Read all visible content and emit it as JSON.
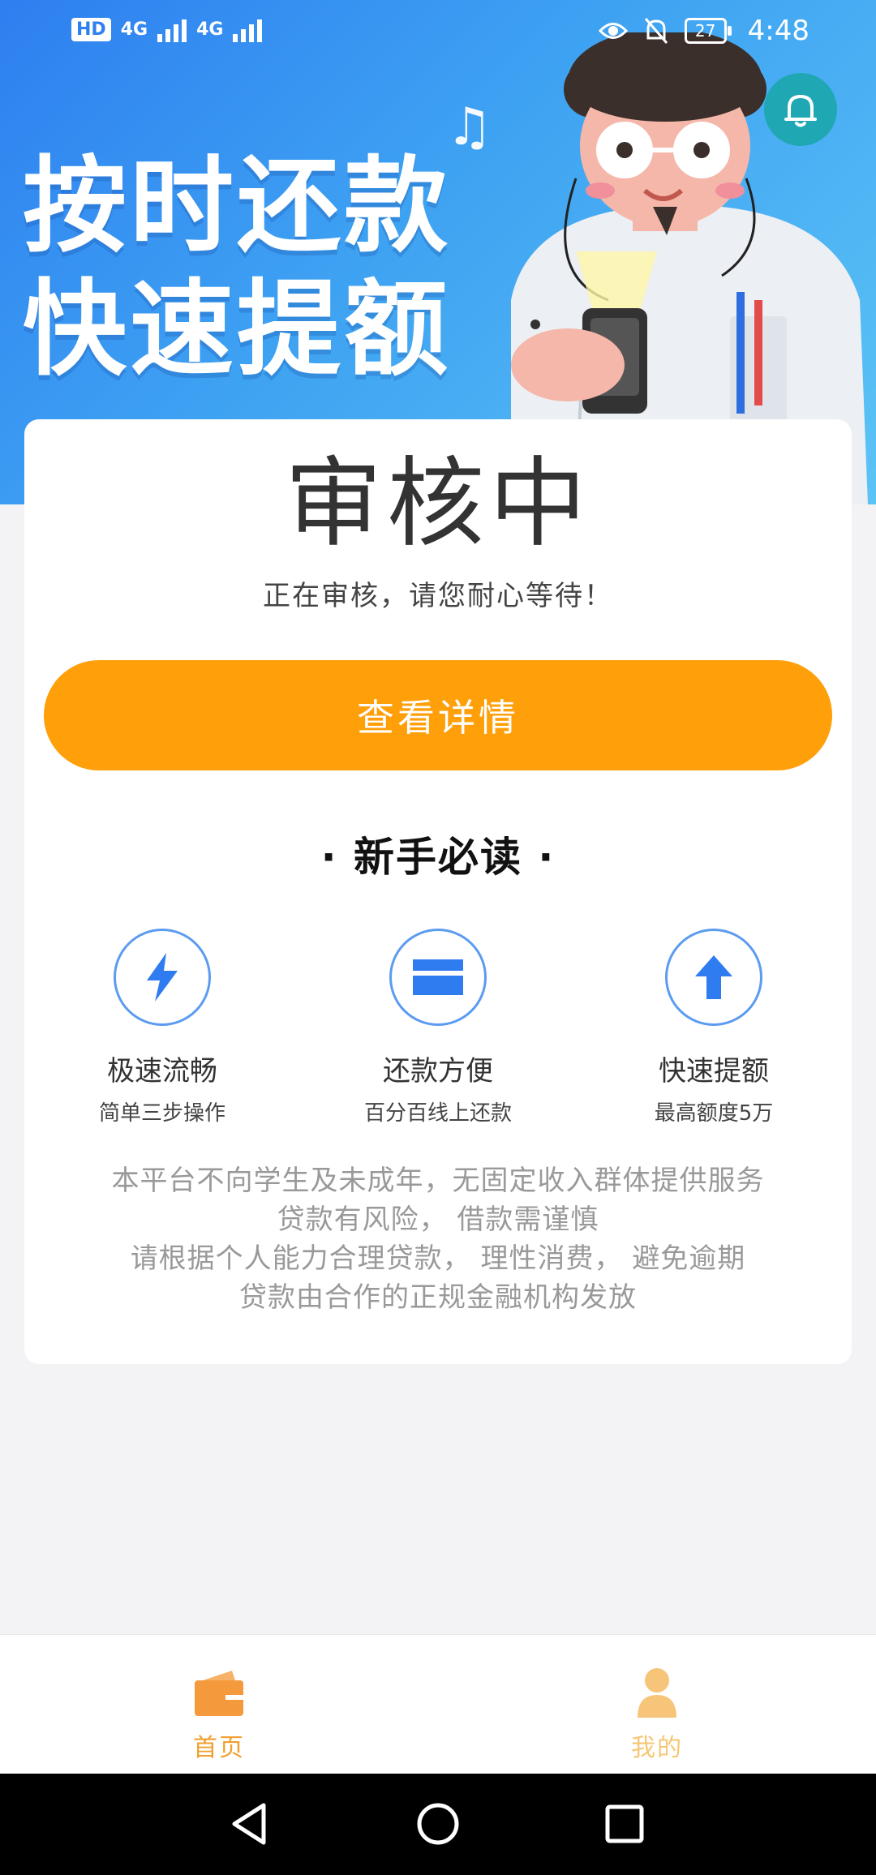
{
  "status_bar": {
    "network_badge": "HD",
    "signal1_label": "4G",
    "signal2_label": "4G",
    "battery": "27",
    "time": "4:48",
    "icons": [
      "eye-icon",
      "bell-off-icon",
      "battery-icon"
    ]
  },
  "banner": {
    "line1": "按时还款",
    "line2": "快速提额",
    "notification_icon": "bell-icon"
  },
  "review": {
    "title": "审核中",
    "description": "正在审核，请您耐心等待！",
    "button_label": "查看详情"
  },
  "guide": {
    "title": "· 新手必读 ·",
    "features": [
      {
        "icon": "lightning-icon",
        "title": "极速流畅",
        "subtitle": "简单三步操作"
      },
      {
        "icon": "card-icon",
        "title": "还款方便",
        "subtitle": "百分百线上还款"
      },
      {
        "icon": "arrow-up-icon",
        "title": "快速提额",
        "subtitle": "最高额度5万"
      }
    ]
  },
  "disclaimer": [
    "本平台不向学生及未成年，无固定收入群体提供服务",
    "贷款有风险， 借款需谨慎",
    "请根据个人能力合理贷款， 理性消费， 避免逾期",
    "贷款由合作的正规金融机构发放"
  ],
  "tabs": [
    {
      "label": "首页",
      "icon": "wallet-icon",
      "active": true
    },
    {
      "label": "我的",
      "icon": "person-icon",
      "active": false
    }
  ],
  "colors": {
    "accent": "#ff9f0a",
    "banner": "#3ea2f2",
    "tab_active": "#f0a031",
    "icon_blue": "#2f7cf0"
  }
}
